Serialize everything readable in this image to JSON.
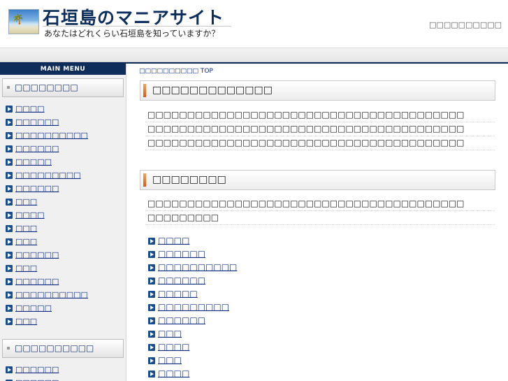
{
  "header": {
    "site_title": "石垣島のマニアサイト",
    "tagline": "あなたはどれくらい石垣島を知っていますか？",
    "top_right_link": "□□□□□□□□□□"
  },
  "sidebar": {
    "menu_heading": "MAIN MENU",
    "box1_title": "□□□□□□□□",
    "items1": [
      "□□□□",
      "□□□□□□",
      "□□□□□□□□□□",
      "□□□□□□",
      "□□□□□",
      "□□□□□□□□□",
      "□□□□□□",
      "□□□",
      "□□□□",
      "□□□",
      "□□□",
      "□□□□□□",
      "□□□",
      "□□□□□□",
      "□□□□□□□□□□",
      "□□□□□",
      "□□□"
    ],
    "box2_title": "□□□□□□□□□□",
    "items2": [
      "□□□□□□",
      "□□□□□□"
    ]
  },
  "main": {
    "breadcrumb": "□□□□□□□□□□ TOP",
    "section1_title": "□□□□□□□□□□□□□",
    "section1_lines": [
      "□□□□□□□□□□□□□□□□□□□□□□□□□□□□□□□□□□□□□□□□",
      "□□□□□□□□□□□□□□□□□□□□□□□□□□□□□□□□□□□□□□□□",
      "□□□□□□□□□□□□□□□□□□□□□□□□□□□□□□□□□□□□□□□□"
    ],
    "section2_title": "□□□□□□□□",
    "section2_lines": [
      "□□□□□□□□□□□□□□□□□□□□□□□□□□□□□□□□□□□□□□□□",
      "□□□□□□□□□"
    ],
    "list": [
      "□□□□",
      "□□□□□□",
      "□□□□□□□□□□",
      "□□□□□□",
      "□□□□□",
      "□□□□□□□□□",
      "□□□□□□",
      "□□□",
      "□□□□",
      "□□□",
      "□□□□"
    ]
  }
}
